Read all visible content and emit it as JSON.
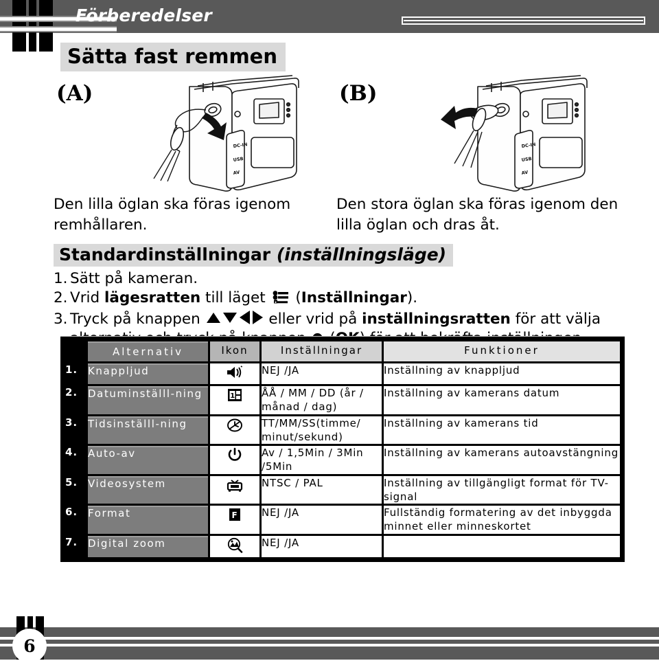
{
  "header": {
    "chapter_title": "Förberedelser"
  },
  "section": {
    "title": "Sätta fast remmen"
  },
  "figures": [
    {
      "label": "(A)",
      "port_labels": [
        "DC-IN",
        "USB",
        "AV"
      ]
    },
    {
      "label": "(B)",
      "port_labels": [
        "DC-IN",
        "USB",
        "AV"
      ]
    }
  ],
  "captions": {
    "a": "Den lilla öglan ska föras igenom remhållaren.",
    "b": "Den stora öglan ska föras igenom den lilla öglan och dras åt."
  },
  "standard_settings": {
    "heading_main": "Standardinställningar",
    "heading_italic": "(inställningsläge)",
    "steps": [
      {
        "num": "1.",
        "parts": [
          {
            "type": "text",
            "value": "Sätt på kameran."
          }
        ]
      },
      {
        "num": "2.",
        "parts": [
          {
            "type": "text",
            "value": "Vrid "
          },
          {
            "type": "bold",
            "value": "lägesratten"
          },
          {
            "type": "text",
            "value": " till läget "
          },
          {
            "type": "icon",
            "value": "setup-mode-icon"
          },
          {
            "type": "text",
            "value": " ("
          },
          {
            "type": "bold",
            "value": "Inställningar"
          },
          {
            "type": "text",
            "value": ")."
          }
        ]
      },
      {
        "num": "3.",
        "parts": [
          {
            "type": "text",
            "value": "Tryck på knappen "
          },
          {
            "type": "icon",
            "value": "arrow-up-icon"
          },
          {
            "type": "icon",
            "value": "arrow-down-icon"
          },
          {
            "type": "icon",
            "value": "arrow-left-icon"
          },
          {
            "type": "icon",
            "value": "arrow-right-icon"
          },
          {
            "type": "text",
            "value": " eller vrid på "
          },
          {
            "type": "bold",
            "value": "inställningsratten"
          },
          {
            "type": "text",
            "value": " för att välja alternativ och tryck på knappen "
          },
          {
            "type": "icon",
            "value": "ok-button-icon"
          },
          {
            "type": "text",
            "value": " ("
          },
          {
            "type": "bold",
            "value": "OK"
          },
          {
            "type": "text",
            "value": ") för att bekräfta inställningen."
          }
        ]
      }
    ]
  },
  "table": {
    "columns": [
      "",
      "Alternativ",
      "Ikon",
      "Inställningar",
      "Funktioner"
    ],
    "rows": [
      {
        "num": "1.",
        "alternativ": "Knappljud",
        "icon": "speaker-icon",
        "installningar": "NEJ /JA",
        "funktioner": "Inställning av knappljud"
      },
      {
        "num": "2.",
        "alternativ": "Datuminställl-ning",
        "icon": "calendar-icon",
        "installningar": "ÅÅ / MM / DD (år / månad / dag)",
        "funktioner": "Inställning av kamerans datum"
      },
      {
        "num": "3.",
        "alternativ": "Tidsinställl-ning",
        "icon": "clock-icon",
        "installningar": "TT/MM/SS(timme/ minut/sekund)",
        "funktioner": "Inställning av kamerans tid"
      },
      {
        "num": "4.",
        "alternativ": "Auto-av",
        "icon": "power-icon",
        "installningar": "Av / 1,5Min / 3Min /5Min",
        "funktioner": "Inställning av kamerans autoavstängning"
      },
      {
        "num": "5.",
        "alternativ": "Videosystem",
        "icon": "tv-icon",
        "installningar": "NTSC / PAL",
        "funktioner": "Inställning av tillgängligt format för TV-signal"
      },
      {
        "num": "6.",
        "alternativ": "Format",
        "icon": "format-icon",
        "installningar": "NEJ /JA",
        "funktioner": "Fullständig formatering av det inbyggda minnet eller minneskortet"
      },
      {
        "num": "7.",
        "alternativ": "Digital zoom",
        "icon": "digital-zoom-icon",
        "installningar": "NEJ /JA",
        "funktioner": ""
      }
    ]
  },
  "footer": {
    "page_number": "6"
  },
  "colors": {
    "band_gray": "#595959",
    "highlight_gray": "#d9d9d9",
    "row_label_gray": "#7d7d7d",
    "black": "#000000",
    "white": "#ffffff"
  }
}
